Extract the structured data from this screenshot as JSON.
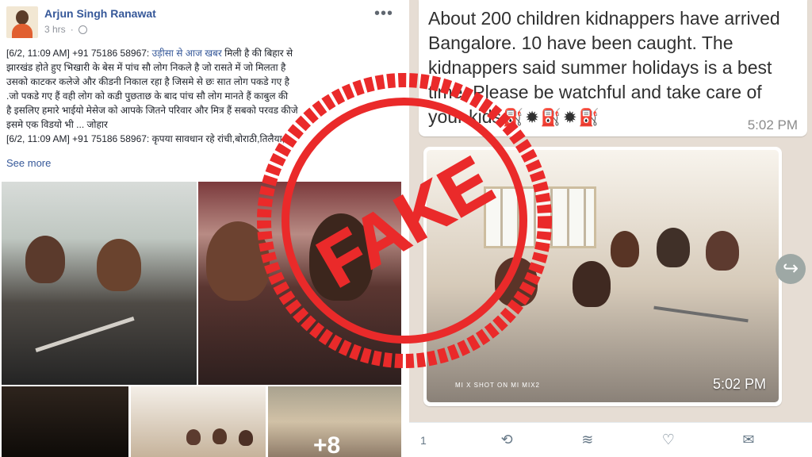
{
  "facebook": {
    "author": "Arjun Singh Ranawat",
    "time": "3 hrs",
    "more": "•••",
    "post_line_1_prefix": "[6/2, 11:09 AM] +91 75186 58967: ",
    "post_line_1_link": "उड़ीसा से आज खबर",
    "post_line_1_suffix": " मिली है की बिहार से",
    "post_text_2": "झारखंड होते हुए भिखारी के बेस में पांच सौ लोग निकले है जो रासते में जो मिलता है",
    "post_text_3": "उसको काटकर कलेजे और कीडनी निकाल रहा है जिसमे से छः सात लोग पकडे गए है",
    "post_text_4": ".जो पकडे गए हैं वही लोग को कडी पुछताछ के बाद पांच सौ लोग मानते हैं काबुल की",
    "post_text_5": "है इसलिए हमारे भाईयो मेसेज को आपके जितने परिवार और मित्र हैं सबको परवड कीजे",
    "post_text_6": "इसमे एक विडयो भी ... जोहार",
    "post_text_7": "[6/2, 11:09 AM] +91 75186 58967: कृपया सावधान रहे रांची,बोराठी,तिलैया,...",
    "see_more": "See more",
    "extra_photos": "+8"
  },
  "whatsapp": {
    "message": "About 200 children kidnappers have arrived Bangalore. 10 have been caught. The kidnappers said summer holidays is a best time. Please be watchful and take care of your kids",
    "message_time": "5:02 PM",
    "image_time": "5:02 PM",
    "watermark": "MI X\nSHOT ON MI MIX2"
  },
  "actions": {
    "reply_count": "1"
  },
  "stamp": {
    "text": "FAKE",
    "color": "#ea2a2a"
  }
}
